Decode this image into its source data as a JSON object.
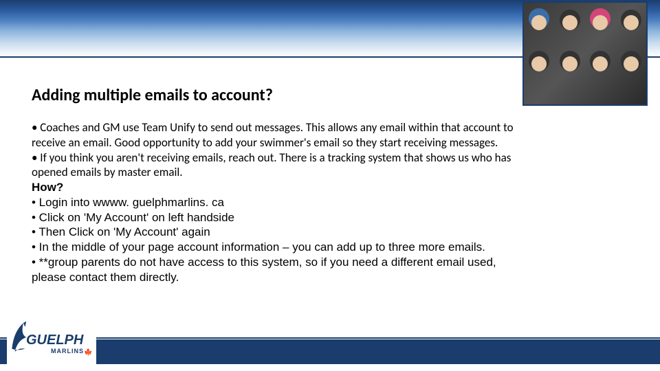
{
  "title": "Adding multiple emails to account?",
  "bullets": {
    "b1a": "• Coaches and GM use Team Unify to send out messages.  This allows any email within that account to",
    "b1b": "receive an email.  Good opportunity to add your swimmer's email so they start receiving messages.",
    "b2a": "• If you think you aren't receiving emails, reach out.  There is a tracking system that shows us who has",
    "b2b": "opened emails by master email.",
    "how": "How?",
    "b3": "• Login into wwww. guelphmarlins. ca",
    "b4": "• Click on 'My Account' on left handside",
    "b5": "• Then Click on 'My Account' again",
    "b6": "• In the middle of your page account information – you can add up to three more emails.",
    "b7a": "• **group parents do not have access to this system, so if you need a different email used,",
    "b7b": "please contact them directly."
  },
  "logo": {
    "main": "GUELPH",
    "sub": "MARLINS",
    "leaf": "🍁"
  }
}
